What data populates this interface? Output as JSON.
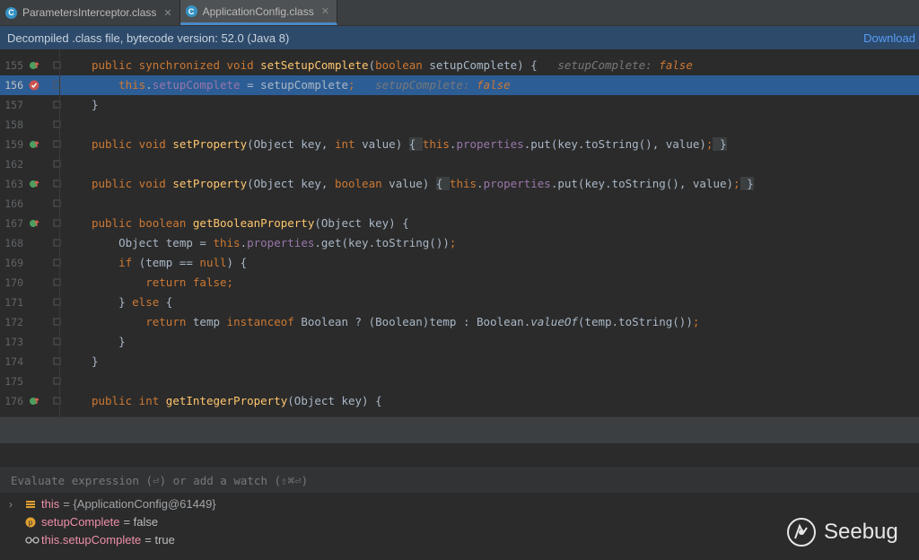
{
  "tabs": [
    {
      "label": "ParametersInterceptor.class",
      "active": false
    },
    {
      "label": "ApplicationConfig.class",
      "active": true
    }
  ],
  "banner": {
    "text": "Decompiled .class file, bytecode version: 52.0 (Java 8)",
    "link": "Download"
  },
  "lines": [
    {
      "n": "155",
      "gutter": "override-breakpoint",
      "segs": [
        [
          "kw",
          "public synchronized void "
        ],
        [
          "fn",
          "setSetupComplete"
        ],
        [
          "",
          "("
        ],
        [
          "kw",
          "boolean "
        ],
        [
          "",
          "setupComplete) {   "
        ],
        [
          "hint",
          "setupComplete: "
        ],
        [
          "hintv",
          "false"
        ]
      ]
    },
    {
      "n": "156",
      "gutter": "breakpoint",
      "hl": true,
      "segs": [
        [
          "",
          "    "
        ],
        [
          "kw",
          "this"
        ],
        [
          "",
          "."
        ],
        [
          "fld",
          "setupComplete"
        ],
        [
          "",
          " = setupComplete"
        ],
        [
          "kw",
          ";"
        ],
        [
          "",
          "   "
        ],
        [
          "hint",
          "setupComplete: "
        ],
        [
          "hintv",
          "false"
        ]
      ]
    },
    {
      "n": "157",
      "segs": [
        [
          "",
          "}"
        ]
      ]
    },
    {
      "n": "158",
      "segs": []
    },
    {
      "n": "159",
      "gutter": "override",
      "segs": [
        [
          "kw",
          "public void "
        ],
        [
          "fn",
          "setProperty"
        ],
        [
          "",
          "(Object key, "
        ],
        [
          "kw",
          "int "
        ],
        [
          "",
          "value) "
        ],
        [
          "brace",
          "{ "
        ],
        [
          "kw",
          "this"
        ],
        [
          "",
          "."
        ],
        [
          "fld",
          "properties"
        ],
        [
          "",
          ".put(key.toString(), value)"
        ],
        [
          "kw",
          ";"
        ],
        [
          "",
          ""
        ],
        [
          "brace",
          " }"
        ]
      ]
    },
    {
      "n": "162",
      "segs": []
    },
    {
      "n": "163",
      "gutter": "override",
      "segs": [
        [
          "kw",
          "public void "
        ],
        [
          "fn",
          "setProperty"
        ],
        [
          "",
          "(Object key, "
        ],
        [
          "kw",
          "boolean "
        ],
        [
          "",
          "value) "
        ],
        [
          "brace",
          "{ "
        ],
        [
          "kw",
          "this"
        ],
        [
          "",
          "."
        ],
        [
          "fld",
          "properties"
        ],
        [
          "",
          ".put(key.toString(), value)"
        ],
        [
          "kw",
          ";"
        ],
        [
          "brace",
          " }"
        ]
      ]
    },
    {
      "n": "166",
      "segs": []
    },
    {
      "n": "167",
      "gutter": "override",
      "segs": [
        [
          "kw",
          "public boolean "
        ],
        [
          "fn",
          "getBooleanProperty"
        ],
        [
          "",
          "(Object key) {"
        ]
      ]
    },
    {
      "n": "168",
      "segs": [
        [
          "",
          "    Object temp = "
        ],
        [
          "kw",
          "this"
        ],
        [
          "",
          "."
        ],
        [
          "fld",
          "properties"
        ],
        [
          "",
          ".get(key.toString())"
        ],
        [
          "kw",
          ";"
        ]
      ]
    },
    {
      "n": "169",
      "segs": [
        [
          "",
          "    "
        ],
        [
          "kw",
          "if "
        ],
        [
          "",
          "(temp == "
        ],
        [
          "kw",
          "null"
        ],
        [
          "",
          ") {"
        ]
      ]
    },
    {
      "n": "170",
      "segs": [
        [
          "",
          "        "
        ],
        [
          "kw",
          "return false;"
        ]
      ]
    },
    {
      "n": "171",
      "segs": [
        [
          "",
          "    } "
        ],
        [
          "kw",
          "else "
        ],
        [
          "",
          "{"
        ]
      ]
    },
    {
      "n": "172",
      "segs": [
        [
          "",
          "        "
        ],
        [
          "kw",
          "return "
        ],
        [
          "",
          "temp "
        ],
        [
          "kw",
          "instanceof "
        ],
        [
          "",
          "Boolean ? (Boolean)temp : Boolean."
        ],
        [
          "it",
          "valueOf"
        ],
        [
          "",
          "(temp.toString())"
        ],
        [
          "kw",
          ";"
        ]
      ]
    },
    {
      "n": "173",
      "segs": [
        [
          "",
          "    }"
        ]
      ]
    },
    {
      "n": "174",
      "segs": [
        [
          "",
          "}"
        ]
      ]
    },
    {
      "n": "175",
      "segs": []
    },
    {
      "n": "176",
      "gutter": "override",
      "segs": [
        [
          "kw",
          "public int "
        ],
        [
          "fn",
          "getIntegerProperty"
        ],
        [
          "",
          "(Object key) {"
        ]
      ]
    }
  ],
  "eval": {
    "placeholder": "Evaluate expression (⏎) or add a watch (⇧⌘⏎)"
  },
  "vars": [
    {
      "icon": "object-icon",
      "name": "this",
      "value": "= {ApplicationConfig@61449}",
      "expand": true
    },
    {
      "icon": "field-icon",
      "name": "setupComplete",
      "value": "= false"
    },
    {
      "icon": "watch-icon",
      "name": "this.setupComplete",
      "value": "= true"
    }
  ],
  "logo": {
    "text": "Seebug"
  },
  "colors": {
    "accent": "#4a88c7",
    "selection": "#2d5d95",
    "banner": "#2d4a6b"
  }
}
